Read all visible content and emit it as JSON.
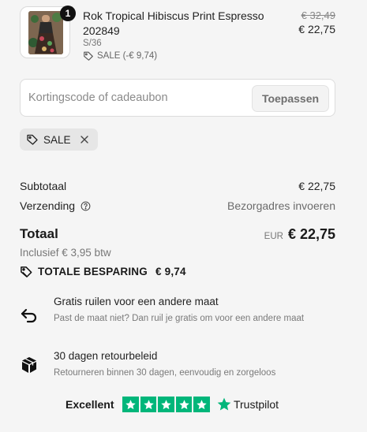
{
  "product": {
    "quantity": "1",
    "name": "Rok Tropical Hibiscus Print Espresso 202849",
    "variant": "S/36",
    "discount_label": "SALE (-€ 9,74)",
    "price_original": "€ 32,49",
    "price_current": "€ 22,75",
    "image": "product-photo-tropical-skirt"
  },
  "discount_code": {
    "placeholder": "Kortingscode of cadeaubon",
    "value": "",
    "apply_label": "Toepassen"
  },
  "applied_tag": {
    "label": "SALE",
    "icon": "tag-icon",
    "remove_icon": "close-icon"
  },
  "summary": {
    "subtotal_label": "Subtotaal",
    "subtotal_value": "€ 22,75",
    "shipping_label": "Verzending",
    "shipping_value": "Bezorgadres invoeren",
    "total_label": "Totaal",
    "currency": "EUR",
    "total_value": "€ 22,75",
    "tax_note": "Inclusief € 3,95 btw",
    "savings_label": "TOTALE BESPARING",
    "savings_value": "€ 9,74"
  },
  "benefits": [
    {
      "icon": "return-arrow-icon",
      "title": "Gratis ruilen voor een andere maat",
      "description": "Past de maat niet? Dan ruil je gratis om voor een andere maat"
    },
    {
      "icon": "package-icon",
      "title": "30 dagen retourbeleid",
      "description": "Retourneren binnen 30 dagen, eenvoudig en zorgeloos"
    }
  ],
  "trustpilot": {
    "rating_word": "Excellent",
    "stars": 5,
    "brand": "Trustpilot",
    "star_color": "#00b67a"
  },
  "colors": {
    "background": "#f5f5f5",
    "text": "#1a1a1a",
    "muted": "#777777",
    "badge": "#111111"
  }
}
